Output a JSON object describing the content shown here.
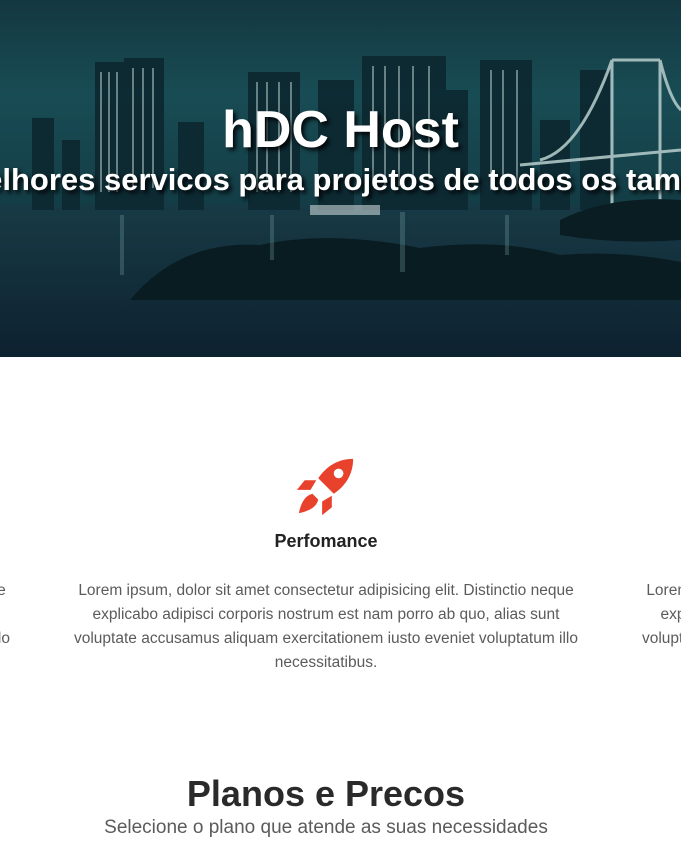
{
  "hero": {
    "title": "hDC Host",
    "subtitle": "Os melhores servicos para projetos de todos os tamanhos"
  },
  "features": [
    {
      "icon": "rocket-icon",
      "title": "Perfomance",
      "text": "Lorem ipsum, dolor sit amet consectetur adipisicing elit. Distinctio neque explicabo adipisci corporis nostrum est nam porro ab quo, alias sunt voluptate accusamus aliquam exercitationem iusto eveniet voluptatum illo necessitatibus."
    }
  ],
  "feature_side_text": "Lorem ipsum, dolor sit amet consectetur adipisicing elit. Distinctio neque explicabo adipisci corporis nostrum est nam porro ab quo, alias sunt voluptate accusamus aliquam exercitationem iusto eveniet voluptatum illo necessitatibus.",
  "pricing": {
    "title": "Planos e Precos",
    "subtitle": "Selecione o plano que atende as suas necessidades"
  },
  "colors": {
    "accent": "#e8412c",
    "heading": "#2a2a2a",
    "body_text": "#5b5b5b"
  }
}
